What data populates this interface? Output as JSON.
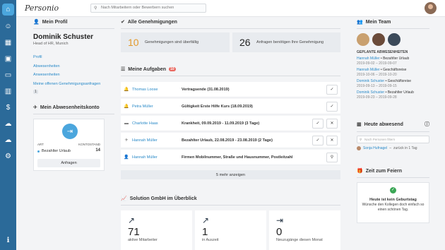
{
  "brand": {
    "logo": "Personio"
  },
  "search": {
    "placeholder": "Nach Mitarbeitern oder Bewerbern suchen"
  },
  "profile": {
    "header": "Mein Profil",
    "name": "Dominik Schuster",
    "title": "Head of HR, Munich",
    "links": [
      "Profil",
      "Abwesenheiten",
      "Anwesenheiten",
      "Meine offenen Genehmigungsanfragen"
    ],
    "open_count": "1"
  },
  "absence_account": {
    "header": "Mein Abwesenheitskonto",
    "col_type": "ART",
    "col_balance": "KONTOSTAND",
    "type": "Bezahlter Urlaub",
    "balance": "14",
    "button": "Anfragen"
  },
  "approvals": {
    "header": "Alle Genehmigungen",
    "overdue_count": "10",
    "overdue_label": "Genehmigungen sind überfällig",
    "pending_count": "26",
    "pending_label": "Anfragen benötigen Ihre Genehmigung"
  },
  "tasks": {
    "header": "Meine Aufgaben",
    "badge": "10",
    "rows": [
      {
        "name": "Thomas Loose",
        "desc": "Vertragsende (31.08.2019)",
        "icon": "bell-icon",
        "buttons": [
          "✓"
        ]
      },
      {
        "name": "Petra Müller",
        "desc": "Gültigkeit Erste Hilfe Kurs (18.09.2019)",
        "icon": "bell-icon",
        "buttons": [
          "✓"
        ]
      },
      {
        "name": "Charlotte Haas",
        "desc": "Krankheit, 09.09.2019 - 11.09.2019 (3 Tage)",
        "icon": "bed-icon",
        "buttons": [
          "✓",
          "✕"
        ]
      },
      {
        "name": "Hannah Müller",
        "desc": "Bezahlter Urlaub, 22.08.2019 - 23.08.2019 (2 Tage)",
        "icon": "plane-icon",
        "buttons": [
          "✓",
          "✕"
        ]
      },
      {
        "name": "Hannah Müller",
        "desc": "Firmen Mobilnummer, Straße und Hausnummer, Postleitzahl",
        "icon": "user-icon",
        "buttons": [
          "⚲"
        ]
      }
    ],
    "more": "5 mehr anzeigen"
  },
  "overview": {
    "header": "Solution GmbH im Überblick",
    "kpis": [
      {
        "value": "71",
        "label": "aktive Mitarbeiter",
        "icon": "trend-up-icon"
      },
      {
        "value": "1",
        "label": "in Auszeit",
        "icon": "trend-up-icon"
      },
      {
        "value": "0",
        "label": "Neuzugänge diesen Monat",
        "icon": "sign-in-icon"
      }
    ]
  },
  "team": {
    "header": "Mein Team",
    "planned_header": "GEPLANTE ABWESENHEITEN",
    "absences": [
      {
        "name": "Hannah Müller",
        "type": "Bezahlter Urlaub",
        "dates": "2019-09-02 – 2019-09-07"
      },
      {
        "name": "Hannah Müller",
        "type": "Geschäftsreise",
        "dates": "2019-10-06 – 2019-10-20"
      },
      {
        "name": "Dominik Schuster",
        "type": "Geschäftsreise",
        "dates": "2019-09-13 – 2019-09-15"
      },
      {
        "name": "Dominik Schuster",
        "type": "Bezahlter Urlaub",
        "dates": "2019-09-23 – 2019-09-28"
      }
    ]
  },
  "today": {
    "header": "Heute abwesend",
    "search_placeholder": "Nach Personen filtern",
    "person": "Sonja Hufnagel",
    "note": "zurück in 1 Tag"
  },
  "celebrate": {
    "header": "Zeit zum Feiern",
    "title": "Heute ist kein Geburtstag",
    "text": "Wünsche den Kollegen doch einfach so einen schönen Tag."
  },
  "colors": {
    "sidebar": "#2b6a99",
    "accent": "#2a8ac8",
    "success": "#3aa655",
    "badge": "#e9675f"
  }
}
